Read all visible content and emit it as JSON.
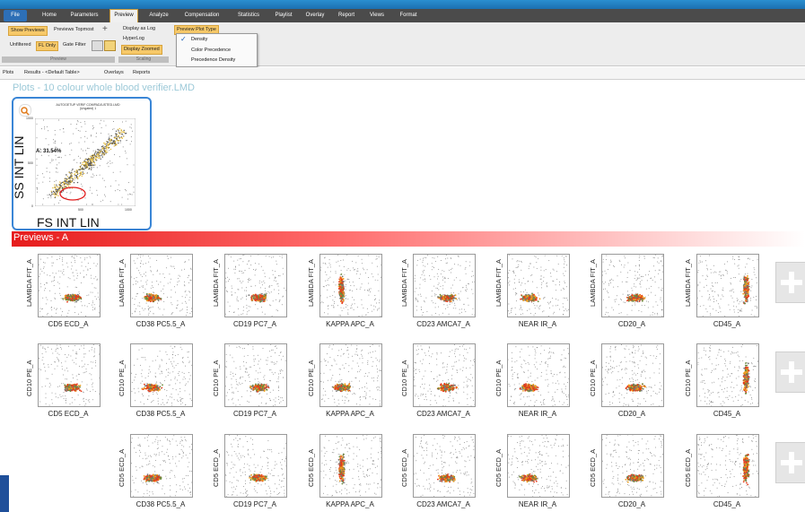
{
  "menu": {
    "tabs": [
      "File",
      "Home",
      "Parameters",
      "Preview",
      "Analyze",
      "Compensation",
      "Statistics",
      "Playlist",
      "Overlay",
      "Report",
      "Views",
      "Format"
    ]
  },
  "ribbon": {
    "show_previews": "Show Previews",
    "previews_topmost": "Previews Topmost",
    "unfiltered": "Unfiltered",
    "fl_only": "FL Only",
    "gate_filter": "Gate Filter",
    "display_as_log": "Display as Log",
    "hyperlog": "HyperLog",
    "display_zoomed": "Display Zoomed",
    "preview_plot_type": "Preview Plot Type",
    "group_preview": "Preview",
    "group_scaling": "Scaling"
  },
  "dropdown": {
    "items": [
      "Density",
      "Color Precedence",
      "Precedence Density"
    ],
    "checked": "Density"
  },
  "panel_tabs": [
    "Plots",
    "Results - <Default Table>",
    "Overlays",
    "Reports"
  ],
  "plots_title": "Plots - 10 colour whole blood verifier.LMD",
  "thumb": {
    "header_line1": "AUTOGETUP VERIF COMPADJUSTED.LMD",
    "header_line2": "(Ungated) 1",
    "ylabel": "SS INT LIN",
    "xlabel": "FS INT LIN",
    "region_label": "A: 31.54%",
    "y_tick_top": "1000",
    "y_tick_mid": "500",
    "y_tick_low": "0",
    "x_tick_mid": "500",
    "x_tick_right": "1000"
  },
  "previews_title": "Previews - A",
  "rows": [
    {
      "ylabel": "LAMBDA FIT_A",
      "xlabels": [
        "CD5 ECD_A",
        "CD38 PC5.5_A",
        "CD19 PC7_A",
        "KAPPA APC_A",
        "CD23 AMCA7_A",
        "NEAR IR_A",
        "CD20_A",
        "CD45_A"
      ]
    },
    {
      "ylabel": "CD10 PE_A",
      "xlabels": [
        "CD5 ECD_A",
        "CD38 PC5.5_A",
        "CD19 PC7_A",
        "KAPPA APC_A",
        "CD23 AMCA7_A",
        "NEAR IR_A",
        "CD20_A",
        "CD45_A"
      ]
    },
    {
      "ylabel": "CD5 ECD_A",
      "xlabels": [
        "",
        "CD38 PC5.5_A",
        "CD19 PC7_A",
        "KAPPA APC_A",
        "CD23 AMCA7_A",
        "NEAR IR_A",
        "CD20_A",
        "CD45_A"
      ]
    }
  ],
  "colors": {
    "ribbon_highlight": "#f7c969",
    "menu_bg": "#4b4b4b",
    "previews_bar": "#e61c1c",
    "title_color": "#9cc9d8"
  }
}
